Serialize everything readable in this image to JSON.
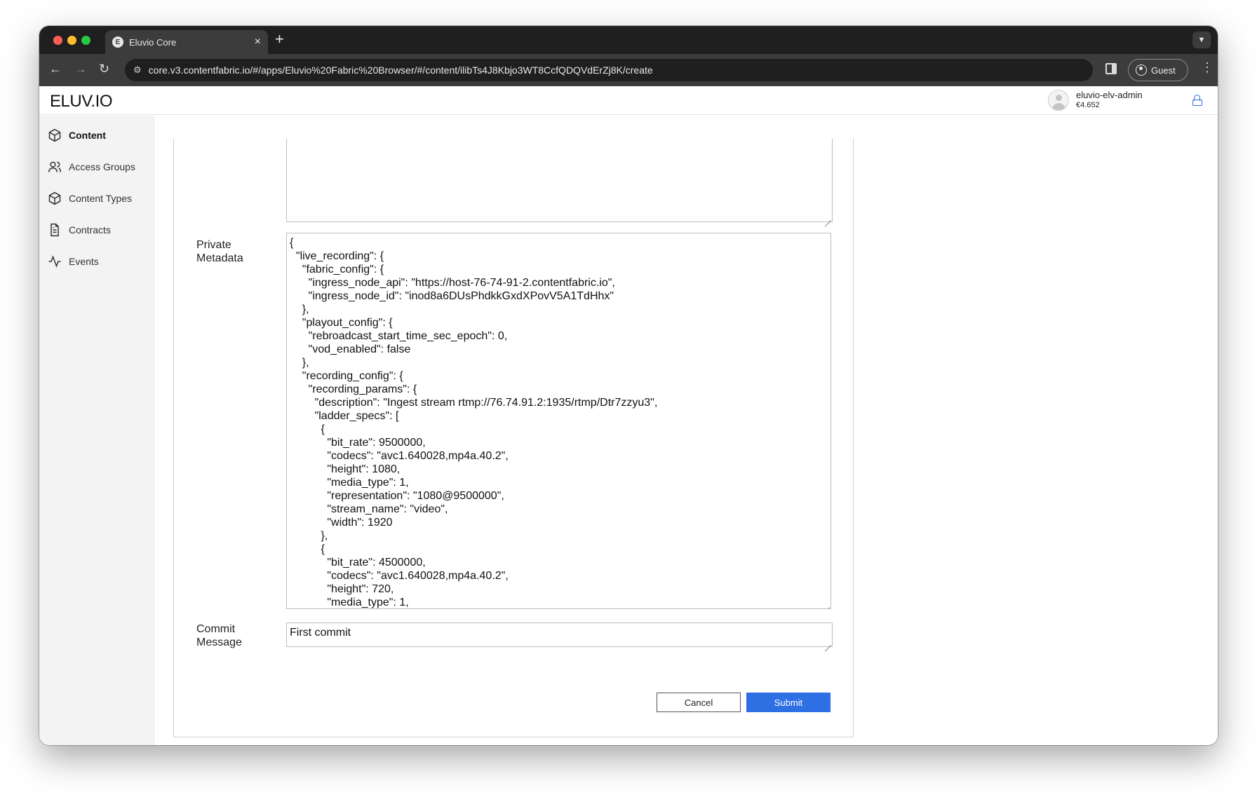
{
  "browser": {
    "tab_title": "Eluvio Core",
    "tab_favicon_letter": "E",
    "url": "core.v3.contentfabric.io/#/apps/Eluvio%20Fabric%20Browser/#/content/ilibTs4J8Kbjo3WT8CcfQDQVdErZj8K/create",
    "profile_label": "Guest"
  },
  "header": {
    "logo": "ELUV.IO",
    "user_name": "eluvio-elv-admin",
    "balance": "€4.652"
  },
  "sidebar": {
    "items": [
      {
        "label": "Content",
        "icon": "box-icon",
        "active": true
      },
      {
        "label": "Access Groups",
        "icon": "users-icon",
        "active": false
      },
      {
        "label": "Content Types",
        "icon": "box-icon",
        "active": false
      },
      {
        "label": "Contracts",
        "icon": "file-text-icon",
        "active": false
      },
      {
        "label": "Events",
        "icon": "activity-icon",
        "active": false
      }
    ]
  },
  "form": {
    "private_metadata_label": "Private\nMetadata",
    "private_metadata_value": "{\n  \"live_recording\": {\n    \"fabric_config\": {\n      \"ingress_node_api\": \"https://host-76-74-91-2.contentfabric.io\",\n      \"ingress_node_id\": \"inod8a6DUsPhdkkGxdXPovV5A1TdHhx\"\n    },\n    \"playout_config\": {\n      \"rebroadcast_start_time_sec_epoch\": 0,\n      \"vod_enabled\": false\n    },\n    \"recording_config\": {\n      \"recording_params\": {\n        \"description\": \"Ingest stream rtmp://76.74.91.2:1935/rtmp/Dtr7zzyu3\",\n        \"ladder_specs\": [\n          {\n            \"bit_rate\": 9500000,\n            \"codecs\": \"avc1.640028,mp4a.40.2\",\n            \"height\": 1080,\n            \"media_type\": 1,\n            \"representation\": \"1080@9500000\",\n            \"stream_name\": \"video\",\n            \"width\": 1920\n          },\n          {\n            \"bit_rate\": 4500000,\n            \"codecs\": \"avc1.640028,mp4a.40.2\",\n            \"height\": 720,\n            \"media_type\": 1,",
    "commit_message_label": "Commit\nMessage",
    "commit_message_value": "First commit",
    "cancel_label": "Cancel",
    "submit_label": "Submit"
  },
  "colors": {
    "accent": "#2f6fe4",
    "sidebar_bg": "#f3f3f3"
  }
}
